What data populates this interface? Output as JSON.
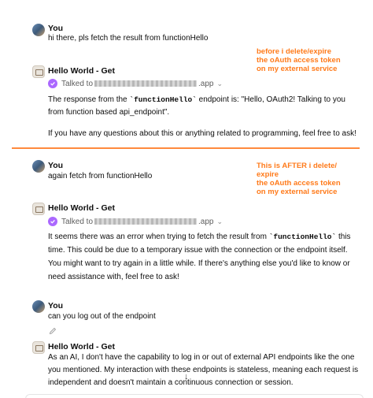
{
  "annotations": {
    "before": [
      "before i delete/expire",
      "the oAuth access token",
      "on my external service"
    ],
    "after": [
      "This is AFTER i delete/",
      "expire",
      "the oAuth access token",
      "on my external service"
    ]
  },
  "messages": [
    {
      "role": "user",
      "sender": "You",
      "text": "hi there, pls fetch the result from functionHello"
    },
    {
      "role": "assistant",
      "sender": "Hello World - Get",
      "talked_prefix": "Talked to",
      "talked_suffix": ".app",
      "text_before_code": "The response from the ",
      "code": "`functionHello`",
      "text_after_code": " endpoint is: \"Hello, OAuth2! Talking to you from function based api_endpoint\".",
      "followup": "If you have any questions about this or anything related to programming, feel free to ask!"
    },
    {
      "role": "user",
      "sender": "You",
      "text": "again fetch from functionHello"
    },
    {
      "role": "assistant",
      "sender": "Hello World - Get",
      "talked_prefix": "Talked to",
      "talked_suffix": ".app",
      "text_before_code": "It seems there was an error when trying to fetch the result from ",
      "code": "`functionHello`",
      "text_after_code": " this time. This could be due to a temporary issue with the connection or the endpoint itself. You might want to try again in a little while. If there's anything else you'd like to know or need assistance with, feel free to ask!"
    },
    {
      "role": "user",
      "sender": "You",
      "text": "can you log out of the endpoint"
    },
    {
      "role": "assistant",
      "sender": "Hello World - Get",
      "text": "As an AI, I don't have the capability to log in or out of external API endpoints like the one you mentioned. My interaction with these endpoints is stateless, meaning each request is independent and doesn't maintain a continuous connection or session."
    }
  ],
  "icons": {
    "verified": "check-circle-icon",
    "expand": "chevron-down-icon",
    "edit": "pencil-icon",
    "scroll": "arrow-down-icon"
  },
  "colors": {
    "annotation": "#ff7a1a",
    "divider": "#ff8a3d",
    "verified": "#ab68ff"
  }
}
